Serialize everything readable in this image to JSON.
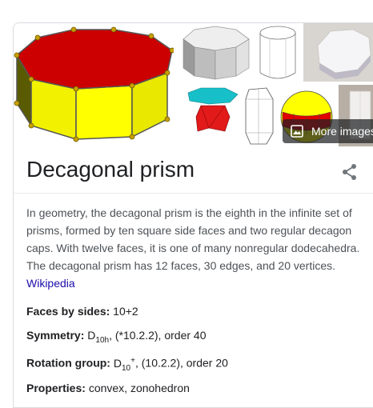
{
  "images": {
    "more_images_label": "More images"
  },
  "title": "Decagonal prism",
  "description": {
    "text": "In geometry, the decagonal prism is the eighth in the infinite set of prisms, formed by ten square side faces and two regular decagon caps. With twelve faces, it is one of many nonregular dodecahedra. The decagonal prism has 12 faces, 30 edges, and 20 vertices.",
    "source_link": "Wikipedia"
  },
  "facts": {
    "faces": {
      "label": "Faces by sides:",
      "value": "10+2"
    },
    "symmetry": {
      "label": "Symmetry:",
      "prefix": "D",
      "sub": "10h",
      "suffix": ", (*10.2.2), order 40"
    },
    "rotation": {
      "label": "Rotation group:",
      "prefix": "D",
      "sub": "10",
      "sup": "+",
      "suffix": ", (10.2.2), order 20"
    },
    "properties": {
      "label": "Properties:",
      "value": "convex, zonohedron"
    }
  },
  "colors": {
    "top_face": "#cc0000",
    "side_face": "#ffff00",
    "link": "#1a0dab"
  }
}
